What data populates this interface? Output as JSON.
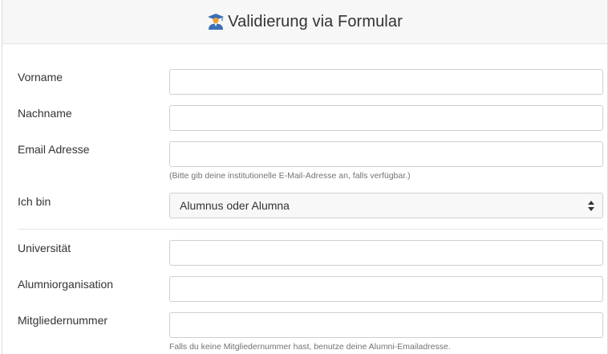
{
  "header": {
    "title": "Validierung via Formular",
    "icon": "graduate-icon"
  },
  "form": {
    "first_name": {
      "label": "Vorname",
      "value": ""
    },
    "last_name": {
      "label": "Nachname",
      "value": ""
    },
    "email": {
      "label": "Email Adresse",
      "value": "",
      "help": "(Bitte gib deine institutionelle E-Mail-Adresse an, falls verfügbar.)"
    },
    "role": {
      "label": "Ich bin",
      "selected": "Alumnus oder Alumna"
    },
    "university": {
      "label": "Universität",
      "value": ""
    },
    "alumni_org": {
      "label": "Alumniorganisation",
      "value": ""
    },
    "member_number": {
      "label": "Mitgliedernummer",
      "value": "",
      "help": "Falls du keine Mitgliedernummer hast, benutze deine Alumni-Emailadresse."
    }
  },
  "colors": {
    "header_bg": "#f7f7f7",
    "icon_blue": "#3b6fb6",
    "icon_orange": "#f0a030"
  }
}
